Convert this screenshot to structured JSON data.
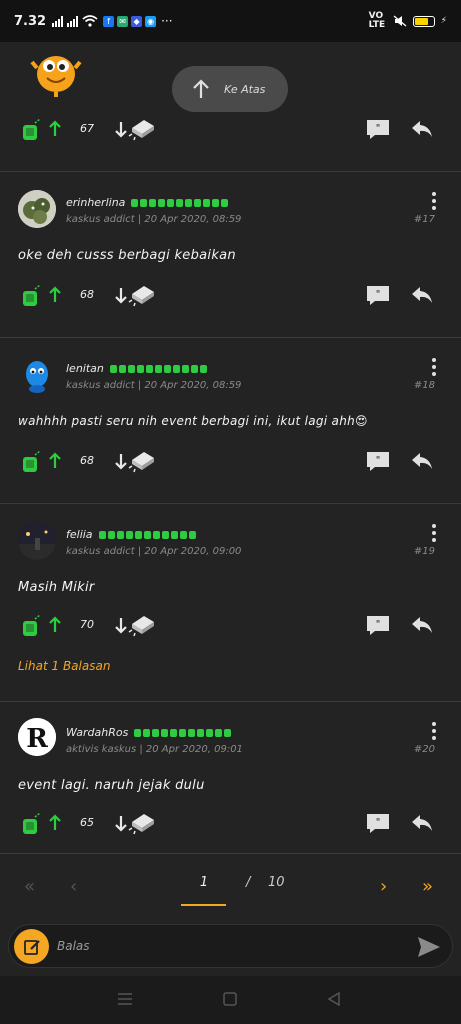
{
  "status_bar": {
    "time": "7.32",
    "more": "···",
    "network": "VO LTE",
    "battery_level": 0.75,
    "colors": {
      "battery": "#f5d400"
    }
  },
  "float_button": {
    "label": "Ke Atas",
    "icon": "arrow-up-icon"
  },
  "posts": [
    {
      "id": "partial",
      "avatar_icon": "emoji-sticker-icon",
      "cendol_count": "67"
    },
    {
      "username": "erinherlina",
      "rank": "kaskus addict",
      "date": "20 Apr 2020, 08:59",
      "number": "#17",
      "text": "oke deh cusss berbagi kebaikan",
      "cendol_count": "68",
      "avatar_icon": "cactus-avatar-icon"
    },
    {
      "username": "lenitan",
      "rank": "kaskus addict",
      "date": "20 Apr 2020, 08:59",
      "number": "#18",
      "text": "wahhhh pasti seru nih event berbagi ini, ikut lagi ahh😍",
      "cendol_count": "68",
      "avatar_icon": "blue-character-avatar-icon"
    },
    {
      "username": "feliia",
      "rank": "kaskus addict",
      "date": "20 Apr 2020, 09:00",
      "number": "#19",
      "text": "Masih Mikir",
      "cendol_count": "70",
      "reply_link": "Lihat 1 Balasan",
      "avatar_icon": "night-photo-avatar-icon"
    },
    {
      "username": "WardahRos",
      "rank": "aktivis kaskus",
      "date": "20 Apr 2020, 09:01",
      "number": "#20",
      "text": "event lagi. naruh jejak dulu",
      "cendol_count": "65",
      "avatar_icon": "letter-r-avatar-icon"
    }
  ],
  "pagination": {
    "current": "1",
    "separator": "/",
    "total": "10"
  },
  "composer": {
    "placeholder": "Balas"
  },
  "colors": {
    "background": "#232323",
    "accent": "#f5a623",
    "cendol_green": "#2ecc40",
    "reputation_green": "#2ecc40"
  }
}
